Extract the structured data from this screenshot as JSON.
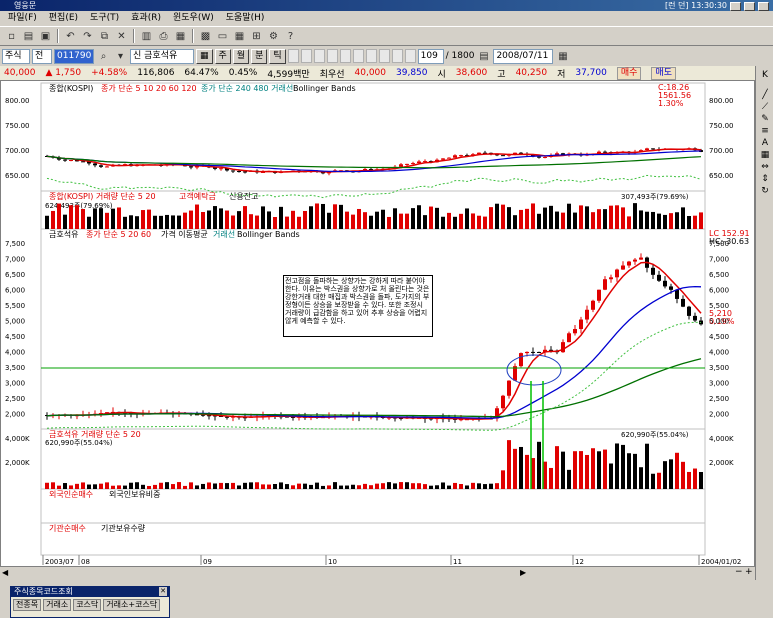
{
  "window": {
    "title": "영웅문",
    "right_labels": [
      "[런 던] 13:30:30"
    ]
  },
  "menu": [
    "파일(F)",
    "편집(E)",
    "도구(T)",
    "효과(R)",
    "윈도우(W)",
    "도움말(H)"
  ],
  "controls": {
    "market": "주식",
    "mode": "전",
    "code": "011790",
    "search": "신 금호석유",
    "periods": [
      "주",
      "월",
      "분",
      "틱"
    ],
    "count": "109",
    "total": "/ 1800",
    "date": "2008/07/11"
  },
  "quote": {
    "price": "40,000",
    "change": "▲ 1,750",
    "change_pct": "+4.58%",
    "volume": "116,806",
    "vol_pct": "64.47%",
    "turnover_pct": "0.45%",
    "amount": "4,599백만",
    "last_label": "최우선",
    "last": "40,000",
    "bid": "39,850",
    "open_label": "시",
    "open": "38,600",
    "high_label": "고",
    "high": "40,250",
    "low_label": "저",
    "low": "37,700",
    "buy_btn": "매수",
    "sell_btn": "매도"
  },
  "panels": {
    "kospi_title": "종합(KOSPI)",
    "kospi_ma_label": "종가 단순 5  10  20  60  120",
    "kospi_ma2": "종가 단순 240  480  거래선",
    "kospi_bb": "Bollinger Bands",
    "kospi_right": [
      "C:18.26",
      "1561.56",
      "1.30%"
    ],
    "kospi_ticks": [
      "800.00",
      "750.00",
      "700.00",
      "650.00"
    ],
    "kvol_title": "종합(KOSPI) 거래량 단순 5  20",
    "kvol_extra": "고객예탁금",
    "kvol_extra2": "신용잔고",
    "kvol_left": "624,493주(79.69%)",
    "kvol_right": "307,493주(79.69%)",
    "stock_title": "금호석유",
    "stock_ma": "종가 단순 5  20  60",
    "stock_ma2": "가격 이동평균",
    "stock_ma3": "거래선",
    "stock_bb": "Bollinger Bands",
    "stock_right": [
      "LC 152.91",
      "HC:-30.63",
      "5,210",
      "0.19%"
    ],
    "stock_ticks": [
      "7,500",
      "7,000",
      "6,500",
      "6,000",
      "5,500",
      "5,000",
      "4,500",
      "4,000",
      "3,500",
      "3,000",
      "2,500",
      "2,000"
    ],
    "annotation": "전고점을 돌파하는 상향가는 강하게 따라 붙어야 한다. 이유는 박스권을 상향가로 처 올린다는 것은 강한거래 대한 매집과 박스권을 돌파, 도가지의 부정형이든 상승을 보장받을 수 있다. 또한 조정시 거래량이 급감함을 하고 있어 추후 상승을 어렵지 않게 예측할 수 있다.",
    "svol_title": "금호석유 거래량 단순 5  20",
    "svol_left": "620,990주(55.04%)",
    "svol_right": "620,990주(55.04%)",
    "svol_ticks": [
      "4,000K",
      "2,000K"
    ],
    "foreign_title": "외국인순매수",
    "foreign_title2": "외국인보유비중",
    "inst_title": "기관순매수",
    "inst_title2": "기관보유수량",
    "xticks": [
      "2003/07",
      "08",
      "09",
      "10",
      "11",
      "12",
      "2004/01/02"
    ]
  },
  "popup": {
    "title": "주식종목코드조회",
    "tabs": [
      "전종목",
      "거래소",
      "코스닥",
      "거래소+코스닥"
    ]
  },
  "colors": {
    "up": "#e00000",
    "down": "#000000",
    "ma5": "#e00000",
    "ma20": "#0000d0",
    "ma60": "#007000"
  }
}
